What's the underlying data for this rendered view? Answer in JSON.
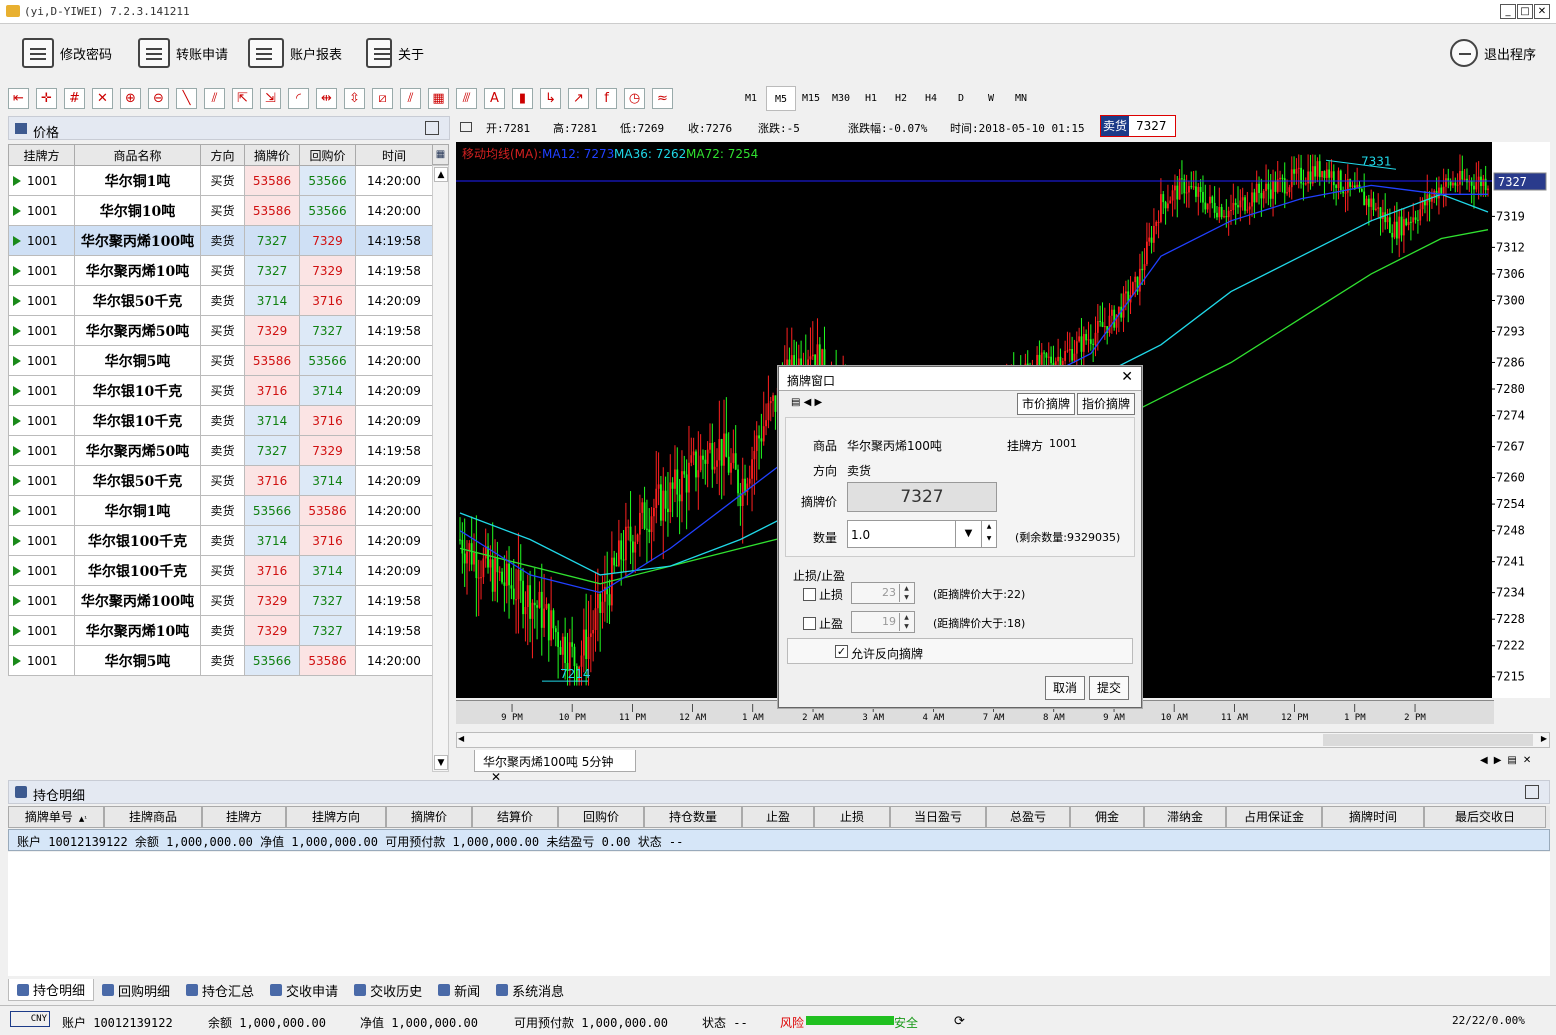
{
  "window": {
    "title": "(yi,D-YIWEI) 7.2.3.141211",
    "min": "_",
    "max": "□",
    "close": "✕"
  },
  "toolbar": {
    "change_pwd": "修改密码",
    "transfer": "转账申请",
    "report": "账户报表",
    "about": "关于",
    "exit": "退出程序"
  },
  "draw_tools": [
    "⇤",
    "✛",
    "#",
    "✕",
    "⊕",
    "⊖",
    "╲",
    "⫽",
    "⇱",
    "⇲",
    "◜",
    "⇹",
    "⇳",
    "⧄",
    "⫽",
    "▦",
    "⫻",
    "A",
    "▮",
    "↳",
    "↗",
    "f",
    "◷",
    "≈"
  ],
  "periods": [
    "M1",
    "M5",
    "M15",
    "M30",
    "H1",
    "H2",
    "H4",
    "D",
    "W",
    "MN"
  ],
  "active_period": "M5",
  "price_panel": {
    "title": "价格"
  },
  "price_table": {
    "headers": [
      "挂牌方",
      "商品名称",
      "方向",
      "摘牌价",
      "回购价",
      "时间"
    ],
    "rows": [
      [
        "1001",
        "华尔铜1吨",
        "买货",
        "53586",
        "53566",
        "14:20:00"
      ],
      [
        "1001",
        "华尔铜10吨",
        "买货",
        "53586",
        "53566",
        "14:20:00"
      ],
      [
        "1001",
        "华尔聚丙烯100吨",
        "卖货",
        "7327",
        "7329",
        "14:19:58"
      ],
      [
        "1001",
        "华尔聚丙烯10吨",
        "买货",
        "7327",
        "7329",
        "14:19:58"
      ],
      [
        "1001",
        "华尔银50千克",
        "卖货",
        "3714",
        "3716",
        "14:20:09"
      ],
      [
        "1001",
        "华尔聚丙烯50吨",
        "买货",
        "7329",
        "7327",
        "14:19:58"
      ],
      [
        "1001",
        "华尔铜5吨",
        "买货",
        "53586",
        "53566",
        "14:20:00"
      ],
      [
        "1001",
        "华尔银10千克",
        "买货",
        "3716",
        "3714",
        "14:20:09"
      ],
      [
        "1001",
        "华尔银10千克",
        "卖货",
        "3714",
        "3716",
        "14:20:09"
      ],
      [
        "1001",
        "华尔聚丙烯50吨",
        "卖货",
        "7327",
        "7329",
        "14:19:58"
      ],
      [
        "1001",
        "华尔银50千克",
        "买货",
        "3716",
        "3714",
        "14:20:09"
      ],
      [
        "1001",
        "华尔铜1吨",
        "卖货",
        "53566",
        "53586",
        "14:20:00"
      ],
      [
        "1001",
        "华尔银100千克",
        "卖货",
        "3714",
        "3716",
        "14:20:09"
      ],
      [
        "1001",
        "华尔银100千克",
        "买货",
        "3716",
        "3714",
        "14:20:09"
      ],
      [
        "1001",
        "华尔聚丙烯100吨",
        "买货",
        "7329",
        "7327",
        "14:19:58"
      ],
      [
        "1001",
        "华尔聚丙烯10吨",
        "卖货",
        "7329",
        "7327",
        "14:19:58"
      ],
      [
        "1001",
        "华尔铜5吨",
        "卖货",
        "53566",
        "53586",
        "14:20:00"
      ]
    ],
    "selected_row": 2
  },
  "chart_info": {
    "open": "开:7281",
    "high": "高:7281",
    "low": "低:7269",
    "close": "收:7276",
    "change": "涨跌:-5",
    "change_pct": "涨跌幅:-0.07%",
    "time": "时间:2018-05-10 01:15",
    "side": "卖货",
    "side_price": "7327"
  },
  "chart_data": {
    "type": "candlestick",
    "legend": {
      "title": "移动均线(MA):",
      "ma12": "MA12: 7273",
      "ma36": "MA36: 7262",
      "ma72": "MA72: 7254"
    },
    "y_ticks": [
      "7319",
      "7312",
      "7306",
      "7300",
      "7293",
      "7286",
      "7280",
      "7274",
      "7267",
      "7260",
      "7254",
      "7248",
      "7241",
      "7234",
      "7228",
      "7222",
      "7215"
    ],
    "ylim": [
      7212,
      7334
    ],
    "x_ticks": [
      "9 PM",
      "10 PM",
      "11 PM",
      "12 AM",
      "1 AM",
      "2 AM",
      "3 AM",
      "4 AM",
      "7 AM",
      "8 AM",
      "9 AM",
      "10 AM",
      "11 AM",
      "12 PM",
      "1 PM",
      "2 PM"
    ],
    "current_price": "7327",
    "high_label": "7331",
    "low_label": "7214",
    "colors": {
      "up": "#ff2020",
      "down": "#20ff20",
      "ma12": "#2040ff",
      "ma36": "#20d8e8",
      "ma72": "#30e030",
      "price_line": "#2020ff"
    },
    "path_points": [
      [
        0,
        7246
      ],
      [
        10,
        7240
      ],
      [
        20,
        7236
      ],
      [
        30,
        7233
      ],
      [
        40,
        7226
      ],
      [
        50,
        7218
      ],
      [
        60,
        7230
      ],
      [
        70,
        7244
      ],
      [
        80,
        7252
      ],
      [
        90,
        7256
      ],
      [
        100,
        7262
      ],
      [
        110,
        7268
      ],
      [
        120,
        7258
      ],
      [
        130,
        7272
      ],
      [
        140,
        7282
      ],
      [
        150,
        7290
      ],
      [
        160,
        7278
      ],
      [
        170,
        7270
      ],
      [
        180,
        7266
      ],
      [
        190,
        7264
      ],
      [
        200,
        7268
      ],
      [
        210,
        7272
      ],
      [
        220,
        7276
      ],
      [
        230,
        7280
      ],
      [
        240,
        7284
      ],
      [
        250,
        7286
      ],
      [
        260,
        7288
      ],
      [
        270,
        7292
      ],
      [
        280,
        7296
      ],
      [
        290,
        7304
      ],
      [
        300,
        7322
      ],
      [
        310,
        7326
      ],
      [
        320,
        7322
      ],
      [
        330,
        7320
      ],
      [
        340,
        7324
      ],
      [
        350,
        7326
      ],
      [
        360,
        7328
      ],
      [
        370,
        7330
      ],
      [
        380,
        7325
      ],
      [
        390,
        7322
      ],
      [
        400,
        7316
      ],
      [
        410,
        7320
      ],
      [
        420,
        7326
      ],
      [
        430,
        7327
      ],
      [
        440,
        7327
      ]
    ],
    "ma12_points": [
      [
        0,
        7248
      ],
      [
        30,
        7238
      ],
      [
        60,
        7234
      ],
      [
        90,
        7244
      ],
      [
        120,
        7256
      ],
      [
        150,
        7268
      ],
      [
        180,
        7270
      ],
      [
        210,
        7272
      ],
      [
        240,
        7280
      ],
      [
        270,
        7288
      ],
      [
        300,
        7310
      ],
      [
        330,
        7318
      ],
      [
        360,
        7323
      ],
      [
        390,
        7326
      ],
      [
        420,
        7324
      ],
      [
        440,
        7324
      ]
    ],
    "ma36_points": [
      [
        0,
        7252
      ],
      [
        30,
        7246
      ],
      [
        60,
        7238
      ],
      [
        90,
        7240
      ],
      [
        120,
        7246
      ],
      [
        150,
        7254
      ],
      [
        180,
        7262
      ],
      [
        210,
        7268
      ],
      [
        240,
        7276
      ],
      [
        270,
        7282
      ],
      [
        300,
        7290
      ],
      [
        330,
        7302
      ],
      [
        360,
        7310
      ],
      [
        390,
        7318
      ],
      [
        420,
        7324
      ],
      [
        440,
        7320
      ]
    ],
    "ma72_points": [
      [
        0,
        7244
      ],
      [
        30,
        7240
      ],
      [
        60,
        7236
      ],
      [
        90,
        7240
      ],
      [
        120,
        7244
      ],
      [
        150,
        7248
      ],
      [
        180,
        7254
      ],
      [
        210,
        7258
      ],
      [
        240,
        7264
      ],
      [
        270,
        7270
      ],
      [
        300,
        7278
      ],
      [
        330,
        7286
      ],
      [
        360,
        7296
      ],
      [
        390,
        7306
      ],
      [
        420,
        7314
      ],
      [
        440,
        7316
      ]
    ]
  },
  "chart_tab": {
    "label": "华尔聚丙烯100吨 5分钟",
    "close": "✕"
  },
  "dialog": {
    "title": "摘牌窗口",
    "close": "✕",
    "tab_market": "市价摘牌",
    "tab_limit": "指价摘牌",
    "product_label": "商品",
    "product": "华尔聚丙烯100吨",
    "lister_label": "挂牌方",
    "lister": "1001",
    "direction_label": "方向",
    "direction": "卖货",
    "price_label": "摘牌价",
    "price": "7327",
    "qty_label": "数量",
    "qty": "1.0",
    "remaining": "(剩余数量:9329035)",
    "sltp_label": "止损/止盈",
    "stop_loss": "止损",
    "sl_value": "23",
    "sl_note": "(距摘牌价大于:22)",
    "take_profit": "止盈",
    "tp_value": "19",
    "tp_note": "(距摘牌价大于:18)",
    "allow_reverse": "允许反向摘牌",
    "cancel": "取消",
    "submit": "提交"
  },
  "positions": {
    "title": "持仓明细",
    "headers": [
      "摘牌单号",
      "挂牌商品",
      "挂牌方",
      "挂牌方向",
      "摘牌价",
      "结算价",
      "回购价",
      "持仓数量",
      "止盈",
      "止损",
      "当日盈亏",
      "总盈亏",
      "佣金",
      "滞纳金",
      "占用保证金",
      "摘牌时间",
      "最后交收日"
    ],
    "sort_mark": "▲¹",
    "account_row": "账户 10012139122  余额 1,000,000.00  净值 1,000,000.00  可用预付款 1,000,000.00  未结盈亏 0.00  状态 --"
  },
  "bottom_tabs": [
    "持仓明细",
    "回购明细",
    "持仓汇总",
    "交收申请",
    "交收历史",
    "新闻",
    "系统消息"
  ],
  "status": {
    "logo": "CNY",
    "account": "账户 10012139122",
    "balance": "余额 1,000,000.00",
    "equity": "净值 1,000,000.00",
    "prepay": "可用预付款 1,000,000.00",
    "state": "状态 --",
    "risk": "风险",
    "safe": "安全",
    "conn": "22/22/0.00%"
  }
}
